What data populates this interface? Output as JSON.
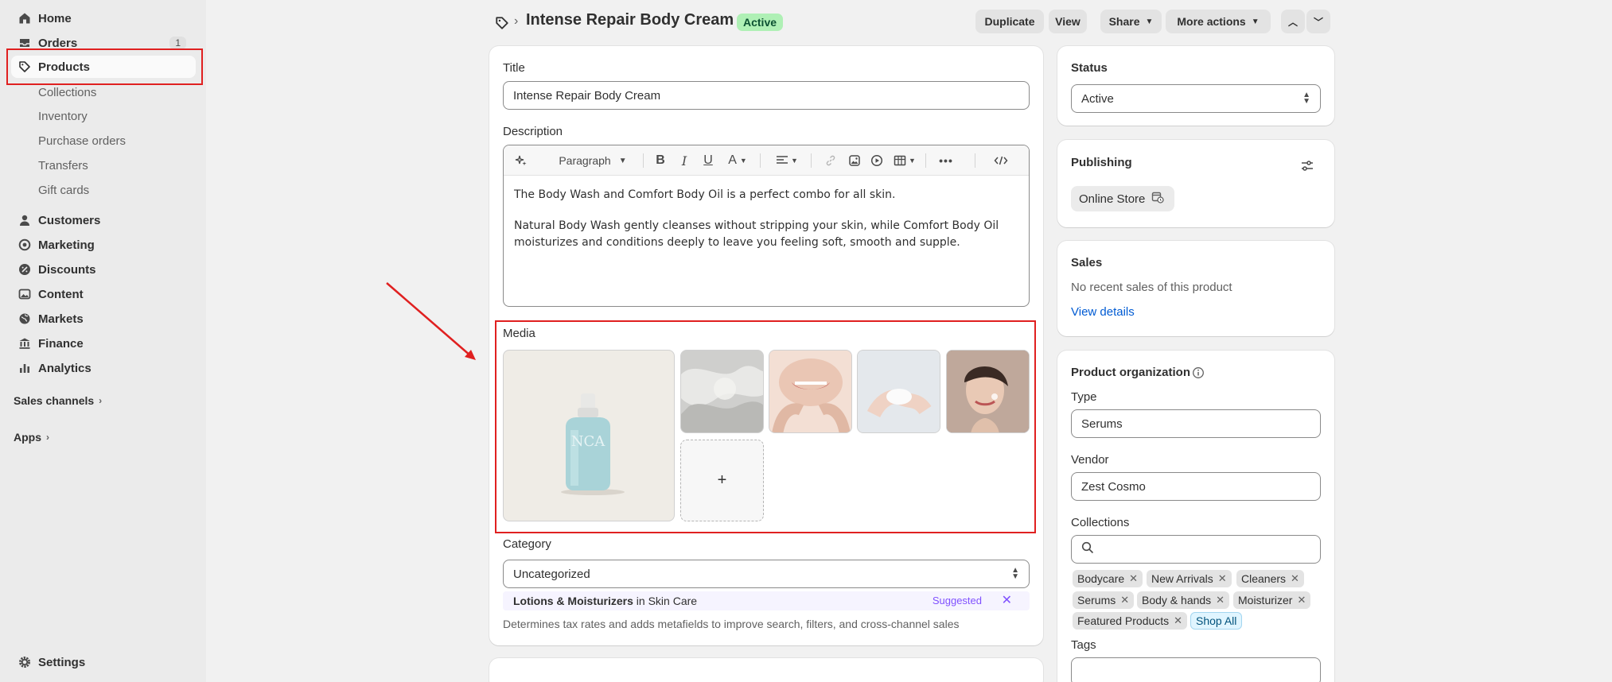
{
  "nav": {
    "items": [
      {
        "label": "Home",
        "icon": "home-icon"
      },
      {
        "label": "Orders",
        "icon": "inbox-icon",
        "badge": "1"
      },
      {
        "label": "Products",
        "icon": "tag-icon"
      }
    ],
    "product_sub": [
      "Collections",
      "Inventory",
      "Purchase orders",
      "Transfers",
      "Gift cards"
    ],
    "items2": [
      {
        "label": "Customers",
        "icon": "person-icon"
      },
      {
        "label": "Marketing",
        "icon": "target-icon"
      },
      {
        "label": "Discounts",
        "icon": "discount-icon"
      },
      {
        "label": "Content",
        "icon": "image-icon"
      },
      {
        "label": "Markets",
        "icon": "globe-icon"
      },
      {
        "label": "Finance",
        "icon": "bank-icon"
      },
      {
        "label": "Analytics",
        "icon": "bar-chart-icon"
      }
    ],
    "sales_channels": "Sales channels",
    "apps": "Apps",
    "settings": "Settings"
  },
  "header": {
    "title": "Intense Repair Body Cream",
    "status_badge": "Active",
    "buttons": {
      "duplicate": "Duplicate",
      "view": "View",
      "share": "Share",
      "more_actions": "More actions"
    }
  },
  "main": {
    "title_label": "Title",
    "title_value": "Intense Repair Body Cream",
    "description_label": "Description",
    "toolbar": {
      "paragraph": "Paragraph"
    },
    "description_paragraphs": [
      "The Body Wash and Comfort Body Oil is a perfect combo for all skin.",
      "Natural Body Wash gently cleanses without stripping your skin, while Comfort Body Oil moisturizes and conditions deeply to leave you feeling soft, smooth and supple."
    ],
    "media_label": "Media",
    "add_media": "+",
    "category_label": "Category",
    "category_value": "Uncategorized",
    "suggestion": {
      "name": "Lotions & Moisturizers",
      "context": " in Skin Care",
      "tag": "Suggested"
    },
    "category_help": "Determines tax rates and adds metafields to improve search, filters, and cross-channel sales"
  },
  "side": {
    "status_title": "Status",
    "status_value": "Active",
    "publishing_title": "Publishing",
    "publishing_channel": "Online Store",
    "sales_title": "Sales",
    "sales_text": "No recent sales of this product",
    "sales_link": "View details",
    "org_title": "Product organization",
    "type_label": "Type",
    "type_value": "Serums",
    "vendor_label": "Vendor",
    "vendor_value": "Zest Cosmo",
    "collections_label": "Collections",
    "collections": [
      "Bodycare",
      "New Arrivals",
      "Cleaners",
      "Serums",
      "Body & hands",
      "Moisturizer",
      "Featured Products"
    ],
    "shop_all": "Shop All",
    "tags_label": "Tags"
  },
  "colors": {
    "highlight": "#e02020",
    "active_badge_bg": "#aff0b5",
    "link": "#005bd3",
    "suggested": "#8051ff"
  }
}
